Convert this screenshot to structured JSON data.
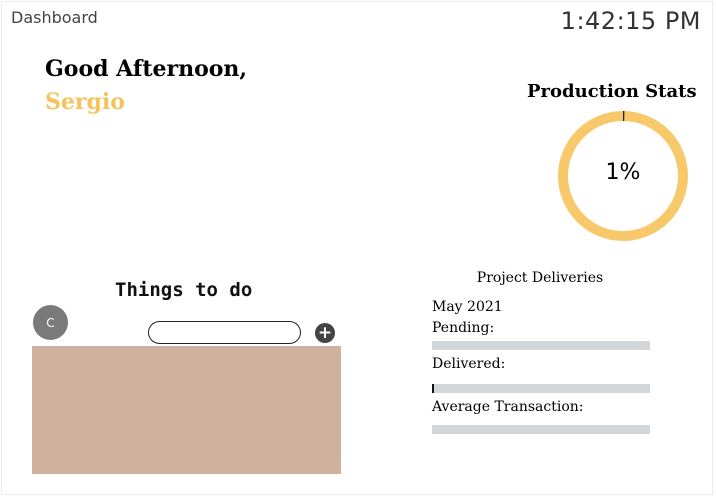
{
  "header": {
    "app_title": "Dashboard",
    "clock": "1:42:15 PM"
  },
  "greeting": {
    "text": "Good Afternoon,",
    "name": "Sergio"
  },
  "production_stats": {
    "title": "Production Stats",
    "percent": 1,
    "percent_label": "1%",
    "ring_color": "#f7c96a",
    "fill_color": "#222222"
  },
  "todo": {
    "title": "Things to do",
    "avatar_initial": "C",
    "input_value": "",
    "input_placeholder": "",
    "add_icon": "plus-circle-icon",
    "panel_color": "#cfb19e"
  },
  "deliveries": {
    "title": "Project Deliveries",
    "month": "May 2021",
    "pending_label": "Pending:",
    "pending_fraction": 0,
    "delivered_label": "Delivered:",
    "delivered_fraction": 0.01,
    "avg_transaction_label": "Average Transaction:",
    "avg_transaction_fraction": 0,
    "track_color": "#d2d6da"
  },
  "colors": {
    "accent": "#f5c35a",
    "background": "#ffffff"
  }
}
